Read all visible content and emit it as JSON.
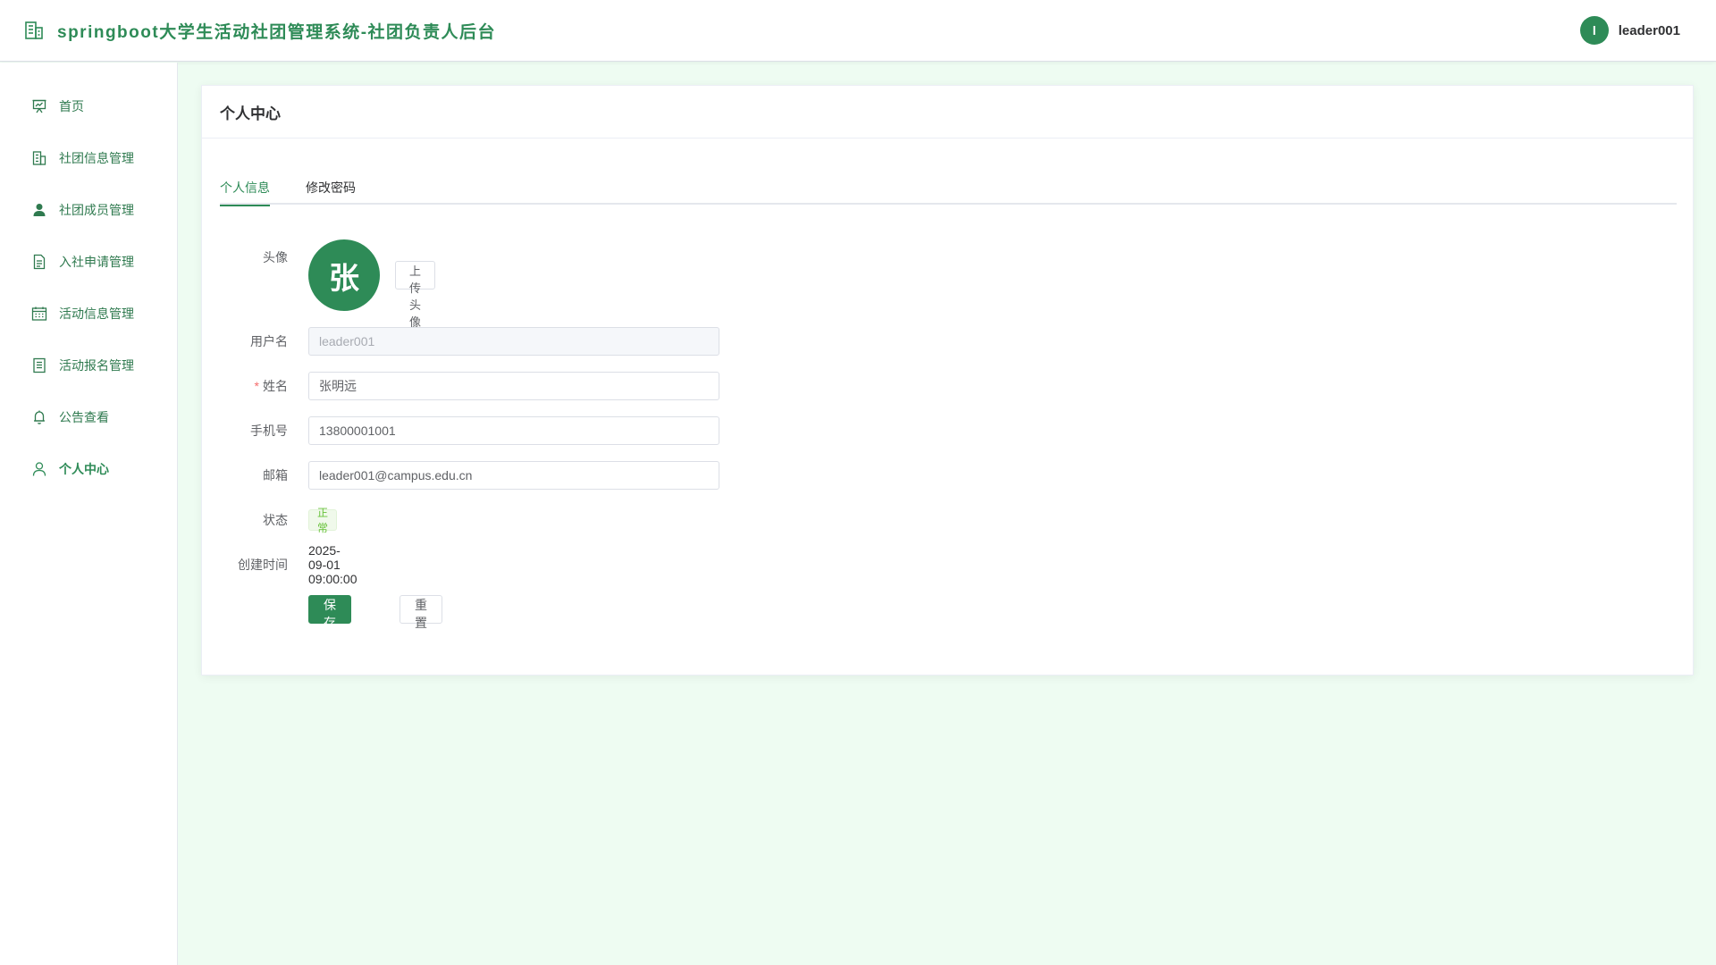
{
  "header": {
    "title": "springboot大学生活动社团管理系统-社团负责人后台",
    "user_avatar_letter": "l",
    "username": "leader001",
    "brand_icon": "building-icon"
  },
  "sidebar": {
    "items": [
      {
        "label": "首页",
        "icon": "presentation-chart-icon"
      },
      {
        "label": "社团信息管理",
        "icon": "building-icon"
      },
      {
        "label": "社团成员管理",
        "icon": "user-filled-icon"
      },
      {
        "label": "入社申请管理",
        "icon": "document-icon"
      },
      {
        "label": "活动信息管理",
        "icon": "calendar-icon"
      },
      {
        "label": "活动报名管理",
        "icon": "notebook-icon"
      },
      {
        "label": "公告查看",
        "icon": "bell-icon"
      },
      {
        "label": "个人中心",
        "icon": "user-icon",
        "active": true
      }
    ]
  },
  "main": {
    "title": "个人中心",
    "tabs": [
      {
        "label": "个人信息",
        "active": true
      },
      {
        "label": "修改密码",
        "active": false
      }
    ],
    "form": {
      "avatar_label": "头像",
      "avatar_text": "张",
      "upload_button": "上传头像",
      "username_label": "用户名",
      "username_value": "leader001",
      "name_required_mark": "*",
      "name_label": "姓名",
      "name_value": "张明远",
      "phone_label": "手机号",
      "phone_value": "13800001001",
      "email_label": "邮箱",
      "email_value": "leader001@campus.edu.cn",
      "status_label": "状态",
      "status_value": "正常",
      "created_label": "创建时间",
      "created_value": "2025-09-01 09:00:00",
      "save_button": "保存修改",
      "reset_button": "重置"
    }
  },
  "colors": {
    "primary": "#2e8b57",
    "background": "#eefcf2",
    "success_tag": "#67c23a",
    "required": "#f56c6c"
  }
}
